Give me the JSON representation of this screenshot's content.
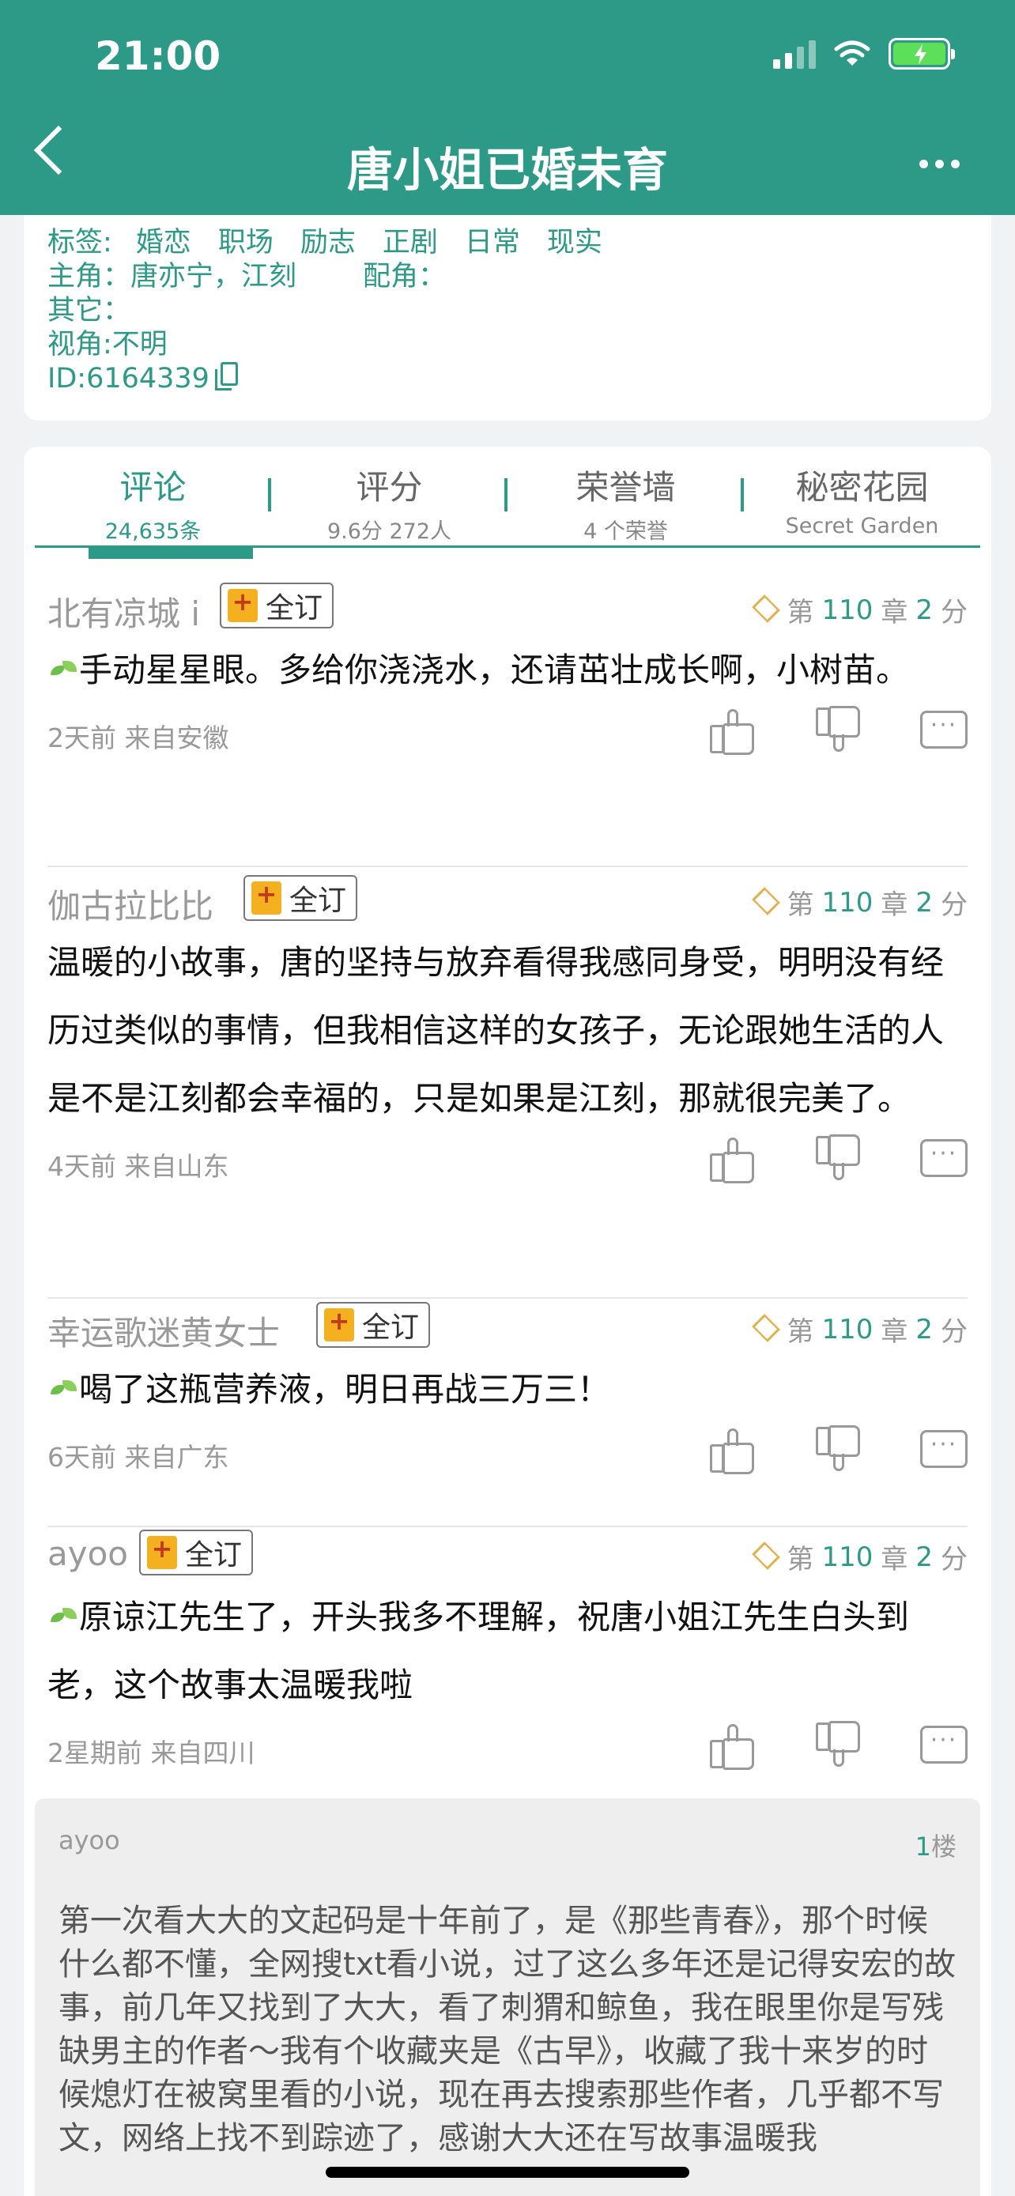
{
  "status": {
    "time": "21:00"
  },
  "nav": {
    "title": "唐小姐已婚未育"
  },
  "info": {
    "tags_label": "标签:",
    "tags": [
      "婚恋",
      "职场",
      "励志",
      "正剧",
      "日常",
      "现实"
    ],
    "protagonist": "主角：唐亦宁，江刻",
    "supporting": "配角：",
    "other": "其它：",
    "perspective": "视角:不明",
    "id": "ID:6164339"
  },
  "tabs": [
    {
      "label": "评论",
      "sub": "24,635条"
    },
    {
      "label": "评分",
      "sub": "9.6分 272人"
    },
    {
      "label": "荣誉墙",
      "sub": "4 个荣誉"
    },
    {
      "label": "秘密花园",
      "sub": "Secret Garden"
    }
  ],
  "comments": [
    {
      "user": "北有凉城 i",
      "badge": "全订",
      "chapter_prefix": "第",
      "chapter": "110",
      "chapter_suffix": "章",
      "score": "2",
      "score_suffix": "分",
      "text": "手动星星眼。多给你浇浇水，还请茁壮成长啊，小树苗。",
      "time": "2天前 来自安徽"
    },
    {
      "user": "伽古拉比比",
      "badge": "全订",
      "chapter_prefix": "第",
      "chapter": "110",
      "chapter_suffix": "章",
      "score": "2",
      "score_suffix": "分",
      "text": "温暖的小故事，唐的坚持与放弃看得我感同身受，明明没有经历过类似的事情，但我相信这样的女孩子，无论跟她生活的人是不是江刻都会幸福的，只是如果是江刻，那就很完美了。",
      "time": "4天前 来自山东"
    },
    {
      "user": "幸运歌迷黄女士",
      "badge": "全订",
      "chapter_prefix": "第",
      "chapter": "110",
      "chapter_suffix": "章",
      "score": "2",
      "score_suffix": "分",
      "text": "喝了这瓶营养液，明日再战三万三！",
      "time": "6天前 来自广东"
    },
    {
      "user": "ayoo",
      "badge": "全订",
      "chapter_prefix": "第",
      "chapter": "110",
      "chapter_suffix": "章",
      "score": "2",
      "score_suffix": "分",
      "text": "原谅江先生了，开头我多不理解，祝唐小姐江先生白头到老，这个故事太温暖我啦",
      "time": "2星期前 来自四川"
    }
  ],
  "reply": {
    "user": "ayoo",
    "floor": "1",
    "floor_suffix": "楼",
    "text": "第一次看大大的文起码是十年前了，是《那些青春》，那个时候什么都不懂，全网搜txt看小说，过了这么多年还是记得安宏的故事，前几年又找到了大大，看了刺猬和鲸鱼，我在眼里你是写残缺男主的作者～我有个收藏夹是《古早》，收藏了我十来岁的时候熄灯在被窝里看的小说，现在再去搜索那些作者，几乎都不写文，网络上找不到踪迹了，感谢大大还在写故事温暖我"
  }
}
